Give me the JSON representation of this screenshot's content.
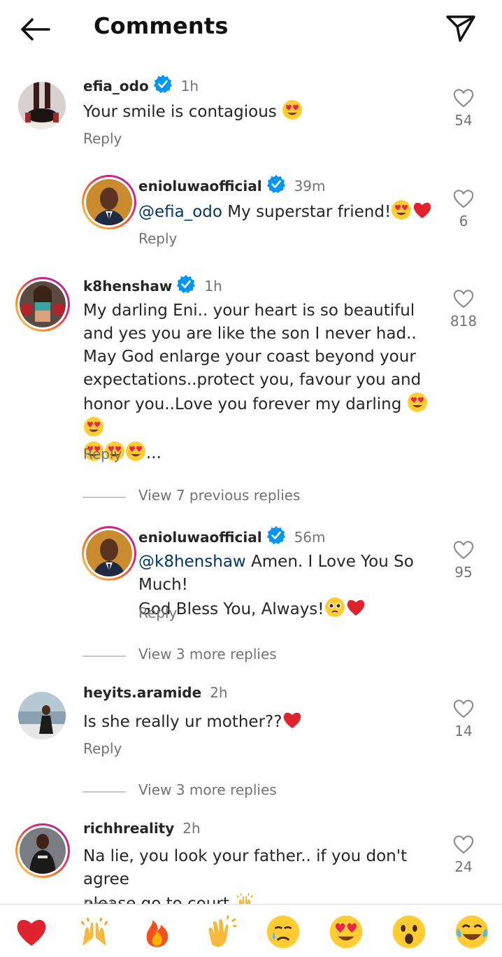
{
  "header": {
    "title": "Comments"
  },
  "comments": [
    {
      "username": "efia_odo",
      "time": "1h",
      "text": "Your smile is contagious",
      "reply_label": "Reply",
      "likes": "54"
    },
    {
      "username": "enioluwaofficial",
      "time": "39m",
      "mention": "@efia_odo",
      "text": "My superstar friend!",
      "reply_label": "Reply",
      "likes": "6"
    },
    {
      "username": "k8henshaw",
      "time": "1h",
      "lines": [
        "My darling Eni.. your heart is so beautiful",
        "and yes you are like the son I never had..",
        "May God enlarge your coast beyond your",
        "expectations..protect you, favour you and",
        "honor you..Love you forever my darling"
      ],
      "ellipsis": "...",
      "reply_label": "Reply",
      "likes": "818"
    },
    {
      "username": "enioluwaofficial",
      "time": "56m",
      "mention": "@k8henshaw",
      "text": "Amen. I Love You So Much!",
      "text2": "God Bless You, Always!",
      "reply_label": "Reply",
      "likes": "95"
    },
    {
      "username": "heyits.aramide",
      "time": "2h",
      "text": "Is she really ur mother??",
      "reply_label": "Reply",
      "likes": "14"
    },
    {
      "username": "richhreality",
      "time": "2h",
      "lines": [
        "Na lie, you look your father.. if you don't agree",
        "please go to court"
      ],
      "reply_label": "Reply",
      "likes": "24"
    }
  ],
  "view_more": [
    "View 7 previous replies",
    "View 3 more replies",
    "View 3 more replies"
  ],
  "colors": {
    "verified": "#0095f6",
    "heart_red": "#ed4956",
    "muted": "#737373"
  },
  "reactions": [
    "red-heart",
    "raising-hands",
    "fire",
    "clapping-hands",
    "crying-face",
    "heart-eyes",
    "surprised-face",
    "tears-of-joy"
  ]
}
